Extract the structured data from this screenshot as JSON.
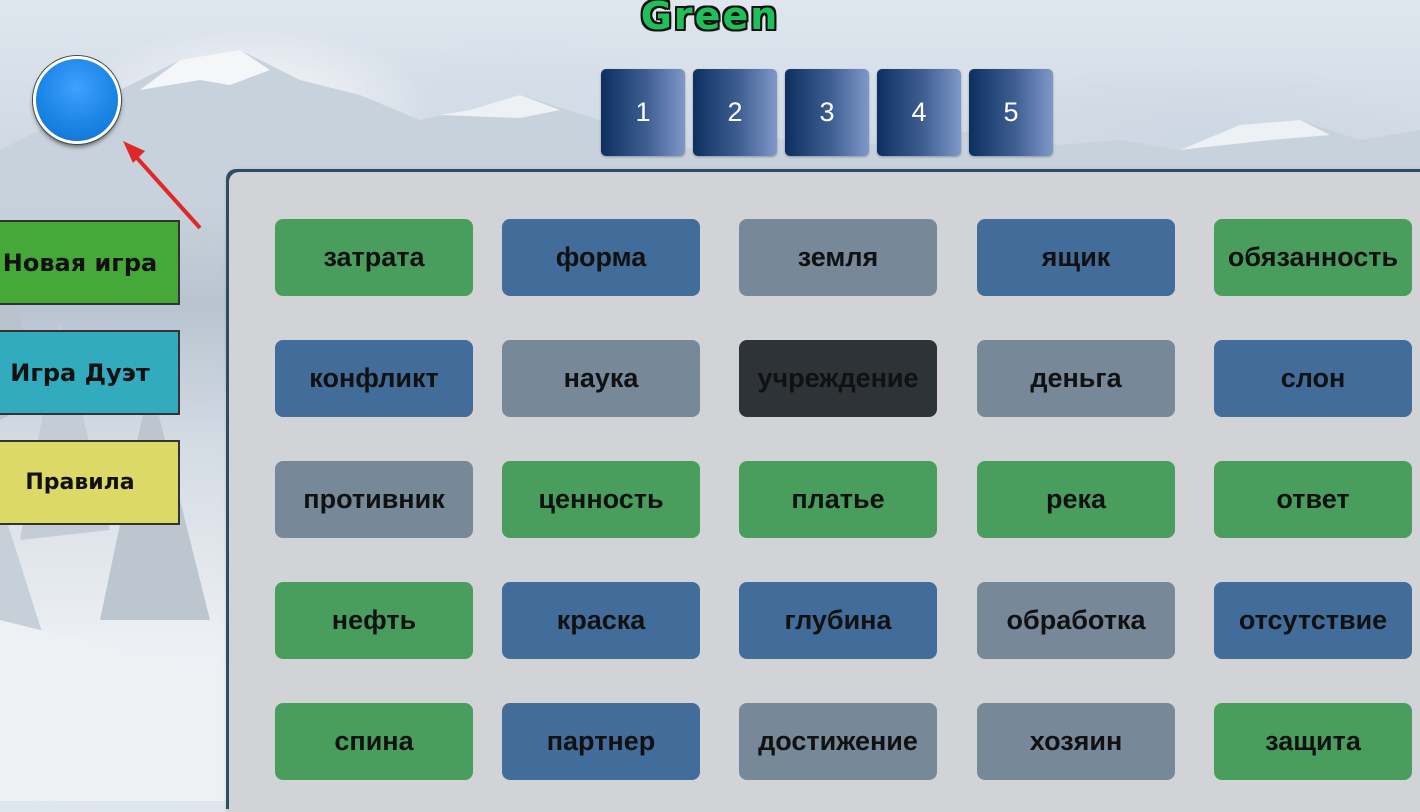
{
  "team_title": "Green",
  "pages": [
    {
      "label": "1"
    },
    {
      "label": "2"
    },
    {
      "label": "3"
    },
    {
      "label": "4"
    },
    {
      "label": "5"
    }
  ],
  "indicator": {
    "color": "#1b86e6",
    "icon": "blue-circle"
  },
  "sidebar": {
    "new_game": "Новая игра",
    "duet_game": "Игра Дуэт",
    "rules": "Правила"
  },
  "colors": {
    "green": "#4a9e5d",
    "blue": "#426d9b",
    "gray": "#778899",
    "black": "#2e3338"
  },
  "cards": [
    {
      "word": "затрата",
      "color": "green"
    },
    {
      "word": "форма",
      "color": "blue"
    },
    {
      "word": "земля",
      "color": "gray"
    },
    {
      "word": "ящик",
      "color": "blue"
    },
    {
      "word": "обязанность",
      "color": "green"
    },
    {
      "word": "конфликт",
      "color": "blue"
    },
    {
      "word": "наука",
      "color": "gray"
    },
    {
      "word": "учреждение",
      "color": "black"
    },
    {
      "word": "деньга",
      "color": "gray"
    },
    {
      "word": "слон",
      "color": "blue"
    },
    {
      "word": "противник",
      "color": "gray"
    },
    {
      "word": "ценность",
      "color": "green"
    },
    {
      "word": "платье",
      "color": "green"
    },
    {
      "word": "река",
      "color": "green"
    },
    {
      "word": "ответ",
      "color": "green"
    },
    {
      "word": "нефть",
      "color": "green"
    },
    {
      "word": "краска",
      "color": "blue"
    },
    {
      "word": "глубина",
      "color": "blue"
    },
    {
      "word": "обработка",
      "color": "gray"
    },
    {
      "word": "отсутствие",
      "color": "blue"
    },
    {
      "word": "спина",
      "color": "green"
    },
    {
      "word": "партнер",
      "color": "blue"
    },
    {
      "word": "достижение",
      "color": "gray"
    },
    {
      "word": "хозяин",
      "color": "gray"
    },
    {
      "word": "защита",
      "color": "green"
    }
  ]
}
